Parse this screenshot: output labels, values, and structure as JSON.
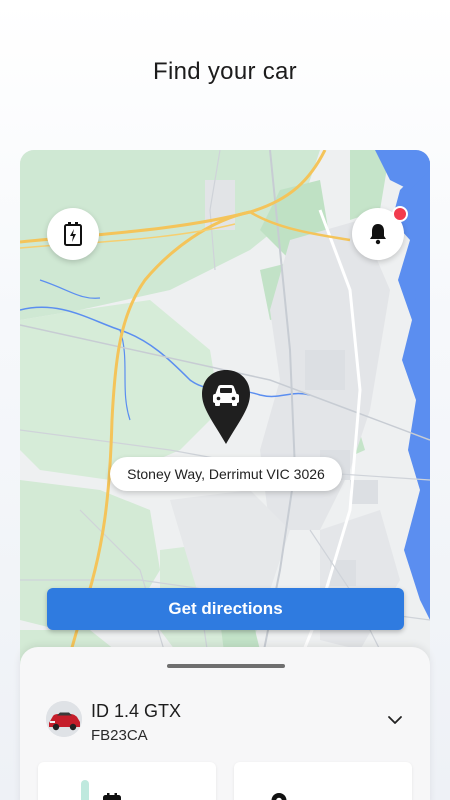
{
  "header": {
    "title": "Find your car"
  },
  "map": {
    "charge_icon": "charging-station-icon",
    "notification_icon": "bell-icon",
    "notification_badge_color": "#f13b4e",
    "pin_icon": "car-icon",
    "address": "Stoney Way, Derrimut VIC 3026",
    "colors": {
      "land": "#eef0f1",
      "park": "#cfe8d3",
      "water": "#5b8ef0",
      "road": "#f4c45a"
    }
  },
  "actions": {
    "directions_label": "Get directions",
    "accent": "#2f7be0"
  },
  "vehicle": {
    "thumbnail_icon": "red-car-image",
    "name": "ID 1.4 GTX",
    "plate": "FB23CA",
    "expand_icon": "chevron-down-icon"
  },
  "stats": {
    "left_icon": "calendar-icon",
    "right_icon": "location-icon"
  }
}
